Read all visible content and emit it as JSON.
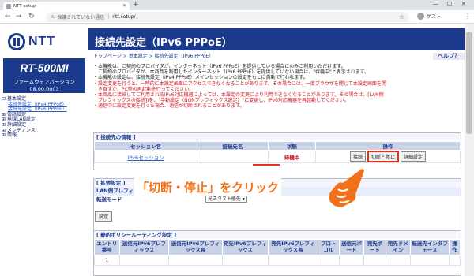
{
  "browser": {
    "tab_title": "NTT setup",
    "security_warning": "保護されていない通信",
    "url": "ntt.setup/",
    "profile_label": "ゲスト"
  },
  "sidebar": {
    "logo_text": "NTT",
    "model": "RT-500MI",
    "firmware_label": "ファームウェアバージョン",
    "firmware_version": "08.00.0003",
    "tree": [
      {
        "label": "基本設定",
        "level": 0
      },
      {
        "label": "接続先設定（IPv4 PPPoE）",
        "level": 1
      },
      {
        "label": "接続先設定（IPv6 PPPoE）",
        "level": 1
      },
      {
        "label": "電話設定",
        "level": 0
      },
      {
        "label": "無線LAN設定",
        "level": 0
      },
      {
        "label": "詳細設定",
        "level": 0
      },
      {
        "label": "メンテナンス",
        "level": 0
      },
      {
        "label": "情報",
        "level": 0
      }
    ]
  },
  "main": {
    "title": "接続先設定（IPv6 PPPoE）",
    "breadcrumb": "トップページ > 基本設定 > 接続先設定（IPv6 PPPoE）",
    "help_label": "ヘルプ？",
    "notes_black": [
      "・本機能は、ご契約のプロバイダが、インターネット（IPv6 PPPoE）を提供している場合にのみご利用いただけます。",
      "　ご契約のプロバイダが、本商品を利用したインターネット（IPv6 PPPoE）を提供していない場合は、\"待機中\"と表示されます。",
      "・本機能の設定は、接続先設定（IPv4 PPPoE）メインセッションの設定をもとに自動で行われます。"
    ],
    "notes_red": [
      "・設定変更を行うと、一時的に本設定画面にアクセスできなくなることがあります。その場合には、一度ブラウザを閉じて本設定画面を開",
      "　き直すか、PC等の再起動を行ってください。",
      "・本商品に接続してご利用されるIPv6対応機器によっては、本設定の変更により利用できなくなることがあります。その場合は、[LAN側",
      "　プレフィックスの接続])を、\"手動設定（NGNプレフィックス設定）\"に変更し、IPv6対応機器を再起動してください。",
      "・通信中に設定変更を行った場合、通信が切断されることがあります。"
    ],
    "connection_panel": {
      "heading": "[ 接続先の情報 ]",
      "columns": [
        "セッション名",
        "接続先名",
        "状態",
        "操作"
      ],
      "row": {
        "session": "IPv6セッション",
        "destination": "",
        "status": "待機中",
        "buttons": [
          "接続",
          "切断・停止",
          "詳細設定"
        ]
      }
    },
    "extension_panel": {
      "heading": "[ 拡張設定 ]",
      "row1_label": "LAN側プレフィックス",
      "row2_label": "転送モード",
      "mode_value": "光ネクスト優先",
      "set_button": "設定"
    },
    "static_routing_panel": {
      "heading": "[ 静的ポリシールーティング設定 ]",
      "columns": [
        "エントリ番号",
        "送信元IPv6プレフィックス",
        "送信元IPv6プレフィックス長",
        "宛先IPv6プレフィックス",
        "宛先IPv6プレフィックス長",
        "プロトコル",
        "送信元ポート",
        "宛先ポート",
        "宛先ドメイン",
        "転送先インタフェース",
        "操作"
      ],
      "first_entry": "1"
    },
    "callout_text": "「切断・停止」をクリック"
  },
  "colors": {
    "brand": "#1c3a8c",
    "warning": "#d0121b",
    "callout": "#f2701a",
    "highlight": "#e8311a"
  }
}
